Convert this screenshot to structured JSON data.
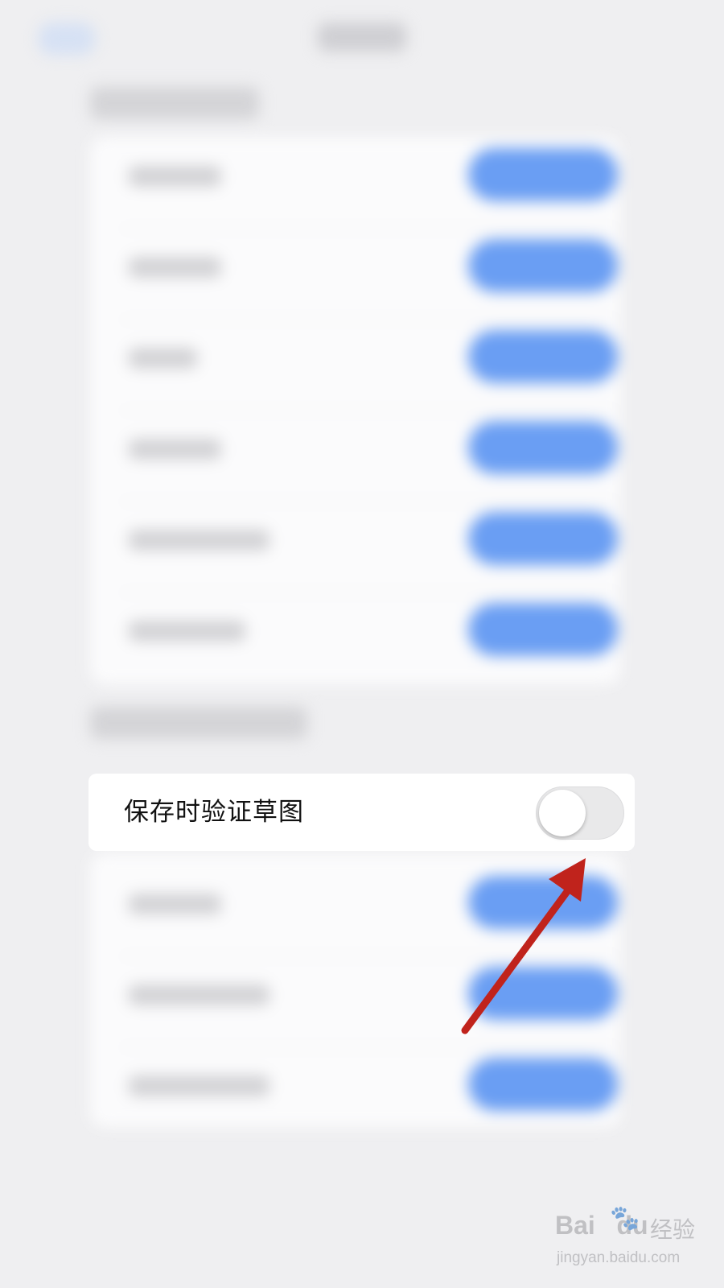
{
  "focus_setting": {
    "label": "保存时验证草图",
    "toggle_on": false
  },
  "colors": {
    "accent_blue": "#6a9ef3",
    "arrow_red": "#c0231c"
  },
  "watermark": {
    "brand": "Bai",
    "brand_suffix": "du",
    "title": "经验",
    "url": "jingyan.baidu.com"
  }
}
